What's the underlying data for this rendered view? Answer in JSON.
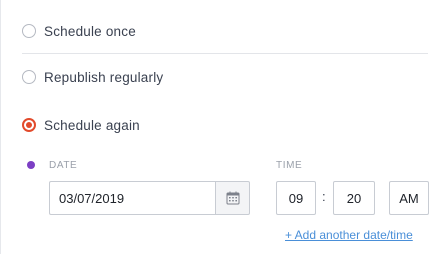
{
  "options": [
    {
      "label": "Schedule once",
      "selected": false
    },
    {
      "label": "Republish regularly",
      "selected": false
    },
    {
      "label": "Schedule again",
      "selected": true
    }
  ],
  "schedule": {
    "date_label": "DATE",
    "date_value": "03/07/2019",
    "time_label": "TIME",
    "hour_value": "09",
    "separator": ":",
    "minute_value": "20",
    "ampm_value": "AM",
    "add_link": "+ Add another date/time",
    "calendar_icon": "calendar-icon"
  },
  "colors": {
    "radio_selected": "#e24a2b",
    "bullet": "#7c3fc4",
    "link": "#4a8fd8"
  }
}
